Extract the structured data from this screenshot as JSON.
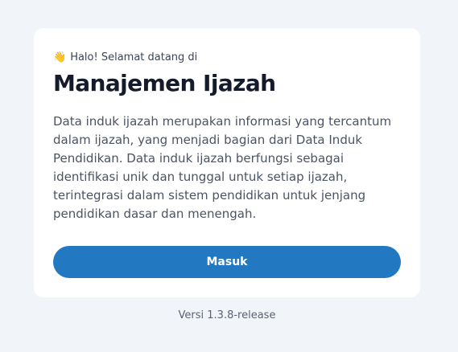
{
  "card": {
    "greeting_icon": "waving-hand-icon",
    "greeting_emoji": "👋",
    "greeting": "Halo! Selamat datang di",
    "title": "Manajemen Ijazah",
    "description": "Data induk ijazah merupakan informasi yang tercantum dalam ijazah, yang menjadi bagian dari Data Induk Pendidikan. Data induk ijazah berfungsi sebagai identifikasi unik dan tunggal untuk setiap ijazah, terintegrasi dalam sistem pendidikan untuk jenjang pendidikan dasar dan menengah.",
    "login_label": "Masuk"
  },
  "footer": {
    "version": "Versi 1.3.8-release"
  },
  "colors": {
    "background": "#f1f4f8",
    "card": "#ffffff",
    "button": "#2278c1",
    "title": "#151b2b",
    "text": "#4b5363"
  }
}
